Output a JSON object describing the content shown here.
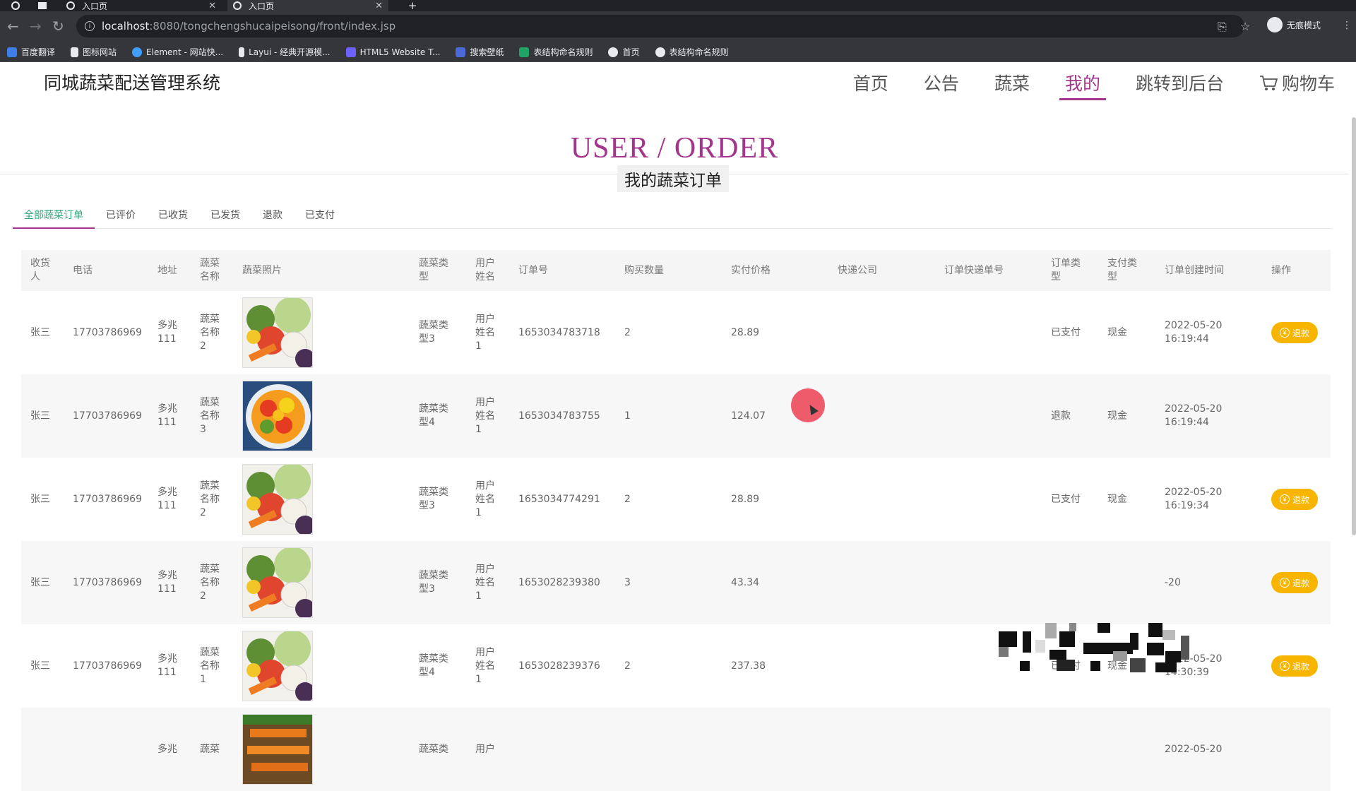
{
  "browser": {
    "tabs": [
      {
        "title": "入口页",
        "active": false
      },
      {
        "title": "入口页",
        "active": true
      }
    ],
    "new_tab": "+",
    "url_host": "localhost",
    "url_path": ":8080/tongchengshucaipeisong/front/index.jsp",
    "profile_label": "无痕模式",
    "bookmarks": [
      "百度翻译",
      "图标网站",
      "Element - 网站快...",
      "Layui - 经典开源模...",
      "HTML5 Website T...",
      "搜索壁纸",
      "表结构命名规则",
      "首页",
      "表结构命名规则"
    ]
  },
  "site": {
    "title": "同城蔬菜配送管理系统",
    "nav": [
      "首页",
      "公告",
      "蔬菜",
      "我的",
      "跳转到后台",
      "购物车"
    ],
    "active_nav": "我的"
  },
  "heading": {
    "en": "USER / ORDER",
    "cn": "我的蔬菜订单"
  },
  "order_tabs": [
    "全部蔬菜订单",
    "已评价",
    "已收货",
    "已发货",
    "退款",
    "已支付"
  ],
  "active_tab": "全部蔬菜订单",
  "table": {
    "headers": [
      "收货人",
      "电话",
      "地址",
      "蔬菜名称",
      "蔬菜照片",
      "蔬菜类型",
      "用户姓名",
      "订单号",
      "购买数量",
      "实付价格",
      "快递公司",
      "订单快递单号",
      "订单类型",
      "支付类型",
      "订单创建时间",
      "操作"
    ],
    "rows": [
      {
        "receiver": "张三",
        "phone": "17703786969",
        "address": "多兆111",
        "veg_name": "蔬菜名称2",
        "photo": "mixed-vegetables",
        "veg_type": "蔬菜类型3",
        "user_name": "用户姓名1",
        "order_no": "1653034783718",
        "qty": "2",
        "price": "28.89",
        "courier": "",
        "tracking": "",
        "order_type": "已支付",
        "pay_type": "现金",
        "created": "2022-05-20 16:19:44",
        "action": "退款"
      },
      {
        "receiver": "张三",
        "phone": "17703786969",
        "address": "多兆111",
        "veg_name": "蔬菜名称3",
        "photo": "peppers-bowl",
        "veg_type": "蔬菜类型4",
        "user_name": "用户姓名1",
        "order_no": "1653034783755",
        "qty": "1",
        "price": "124.07",
        "courier": "",
        "tracking": "",
        "order_type": "退款",
        "pay_type": "现金",
        "created": "2022-05-20 16:19:44",
        "action": ""
      },
      {
        "receiver": "张三",
        "phone": "17703786969",
        "address": "多兆111",
        "veg_name": "蔬菜名称2",
        "photo": "mixed-vegetables",
        "veg_type": "蔬菜类型3",
        "user_name": "用户姓名1",
        "order_no": "1653034774291",
        "qty": "2",
        "price": "28.89",
        "courier": "",
        "tracking": "",
        "order_type": "已支付",
        "pay_type": "现金",
        "created": "2022-05-20 16:19:34",
        "action": "退款"
      },
      {
        "receiver": "张三",
        "phone": "17703786969",
        "address": "多兆111",
        "veg_name": "蔬菜名称2",
        "photo": "mixed-vegetables",
        "veg_type": "蔬菜类型3",
        "user_name": "用户姓名1",
        "order_no": "1653028239380",
        "qty": "3",
        "price": "43.34",
        "courier": "",
        "tracking": "",
        "order_type": "",
        "pay_type": "",
        "created": "-20",
        "action": "退款"
      },
      {
        "receiver": "张三",
        "phone": "17703786969",
        "address": "多兆111",
        "veg_name": "蔬菜名称1",
        "photo": "mixed-vegetables",
        "veg_type": "蔬菜类型4",
        "user_name": "用户姓名1",
        "order_no": "1653028239376",
        "qty": "2",
        "price": "237.38",
        "courier": "",
        "tracking": "",
        "order_type": "已支付",
        "pay_type": "现金",
        "created": "2022-05-20 14:30:39",
        "action": "退款"
      },
      {
        "receiver": "",
        "phone": "",
        "address": "多兆",
        "veg_name": "蔬菜",
        "photo": "carrots",
        "veg_type": "蔬菜类",
        "user_name": "用户",
        "order_no": "",
        "qty": "",
        "price": "",
        "courier": "",
        "tracking": "",
        "order_type": "",
        "pay_type": "",
        "created": "2022-05-20",
        "action": ""
      }
    ]
  },
  "colors": {
    "accent": "#a4358c",
    "tab_active_text": "#2ea77a",
    "refund_button": "#f7b500",
    "cursor_highlight": "#ee5b6b"
  }
}
